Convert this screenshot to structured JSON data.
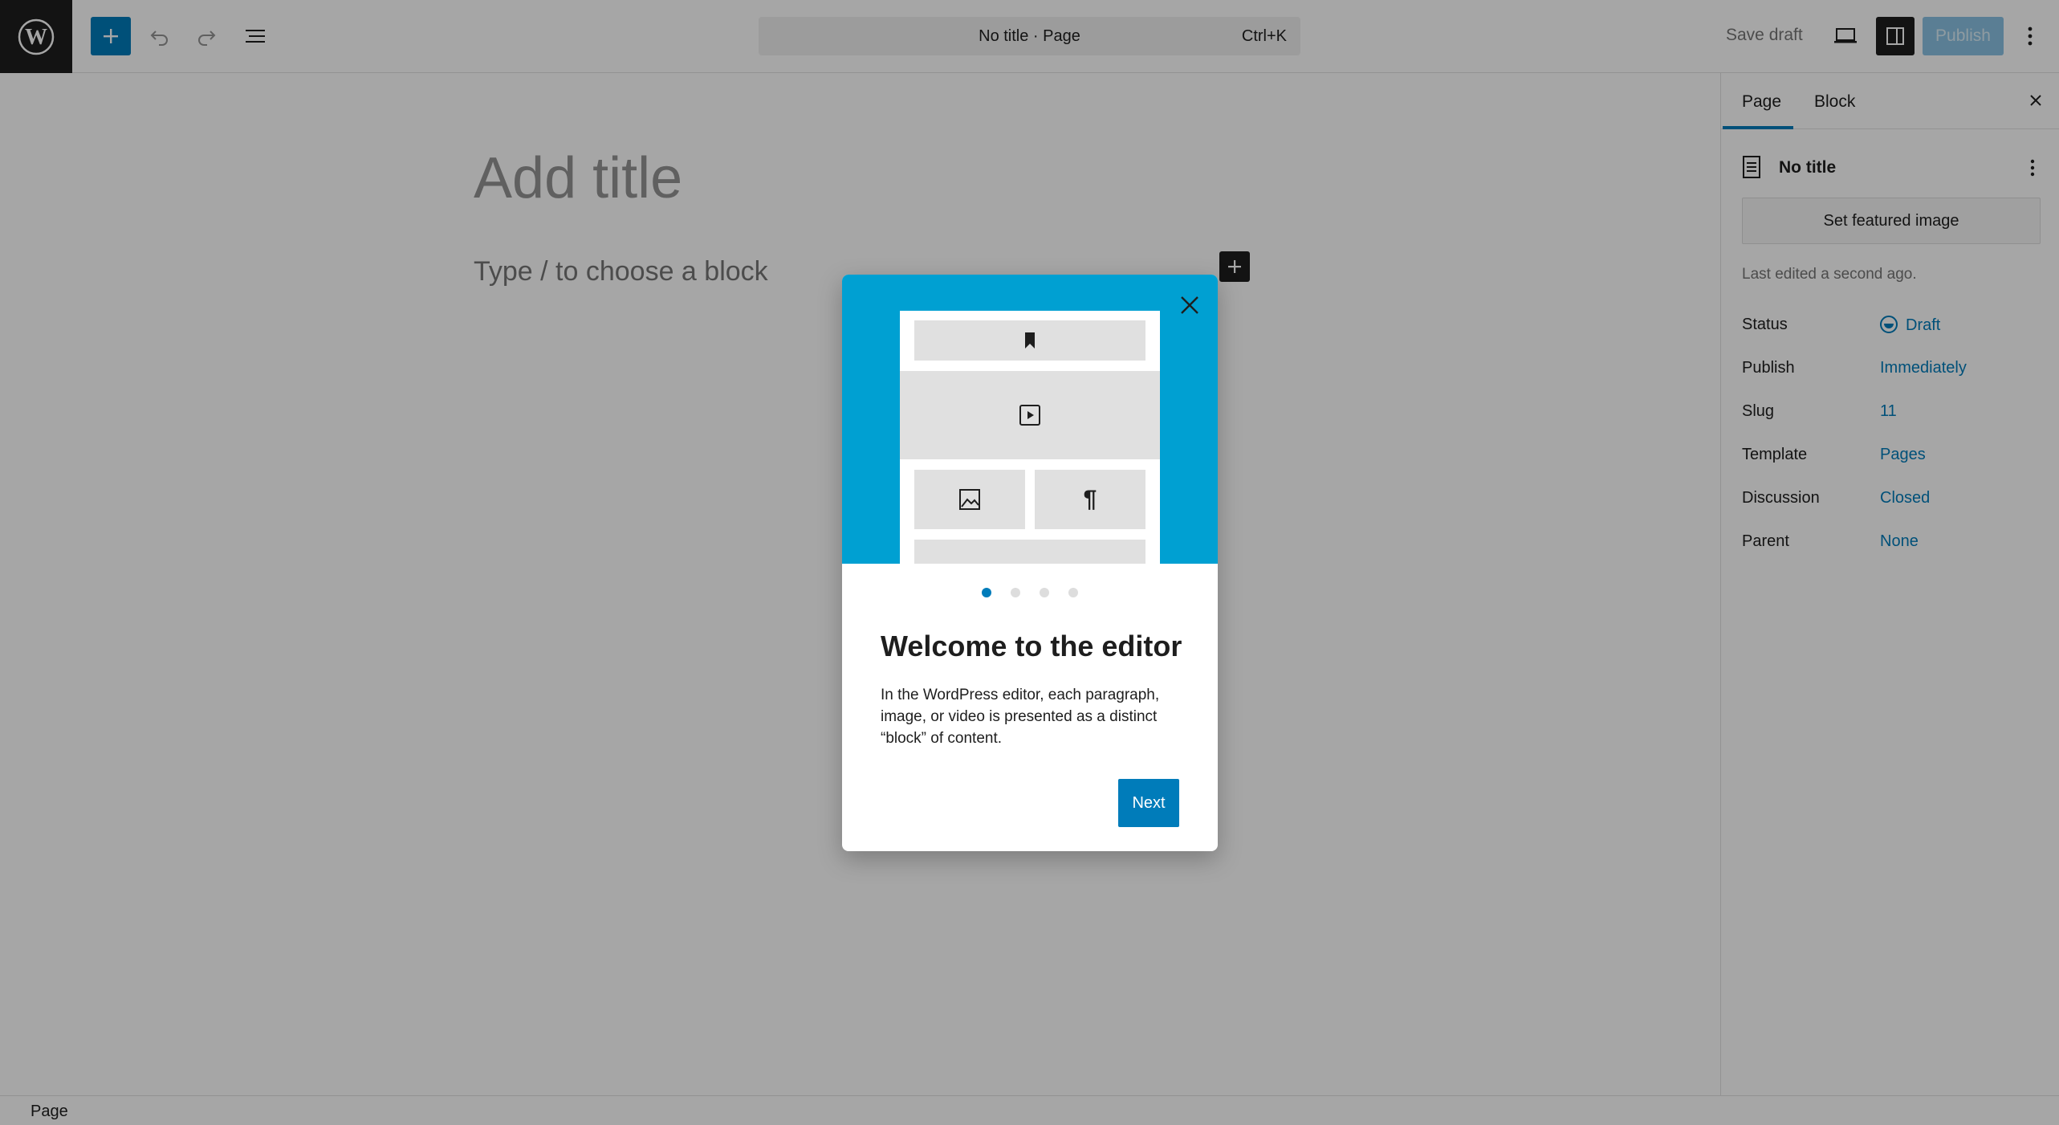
{
  "toolbar": {
    "logo": "wordpress-logo",
    "inserter_icon": "plus-icon",
    "undo_icon": "undo-icon",
    "redo_icon": "redo-icon",
    "list_view_icon": "list-view-icon",
    "command_title": "No title · Page",
    "command_shortcut": "Ctrl+K",
    "save_draft": "Save draft",
    "preview_icon": "desktop-icon",
    "settings_icon": "sidebar-icon",
    "publish": "Publish",
    "more_icon": "more-vertical-icon"
  },
  "editor": {
    "title_placeholder": "Add title",
    "block_placeholder": "Type / to choose a block"
  },
  "sidebar": {
    "tabs": [
      "Page",
      "Block"
    ],
    "active_tab": "Page",
    "document_title": "No title",
    "featured_image_button": "Set featured image",
    "last_edited": "Last edited a second ago.",
    "meta": [
      {
        "label": "Status",
        "value": "Draft"
      },
      {
        "label": "Publish",
        "value": "Immediately"
      },
      {
        "label": "Slug",
        "value": "11"
      },
      {
        "label": "Template",
        "value": "Pages"
      },
      {
        "label": "Discussion",
        "value": "Closed"
      },
      {
        "label": "Parent",
        "value": "None"
      }
    ]
  },
  "footer": {
    "breadcrumb": "Page"
  },
  "modal": {
    "heading": "Welcome to the editor",
    "body": "In the WordPress editor, each paragraph, image, or video is presented as a distinct “block” of content.",
    "next_button": "Next",
    "page_count": 4,
    "current_page": 1
  },
  "colors": {
    "accent": "#007cba",
    "hero_bg": "#00a0d2",
    "dark": "#1e1e1e"
  }
}
